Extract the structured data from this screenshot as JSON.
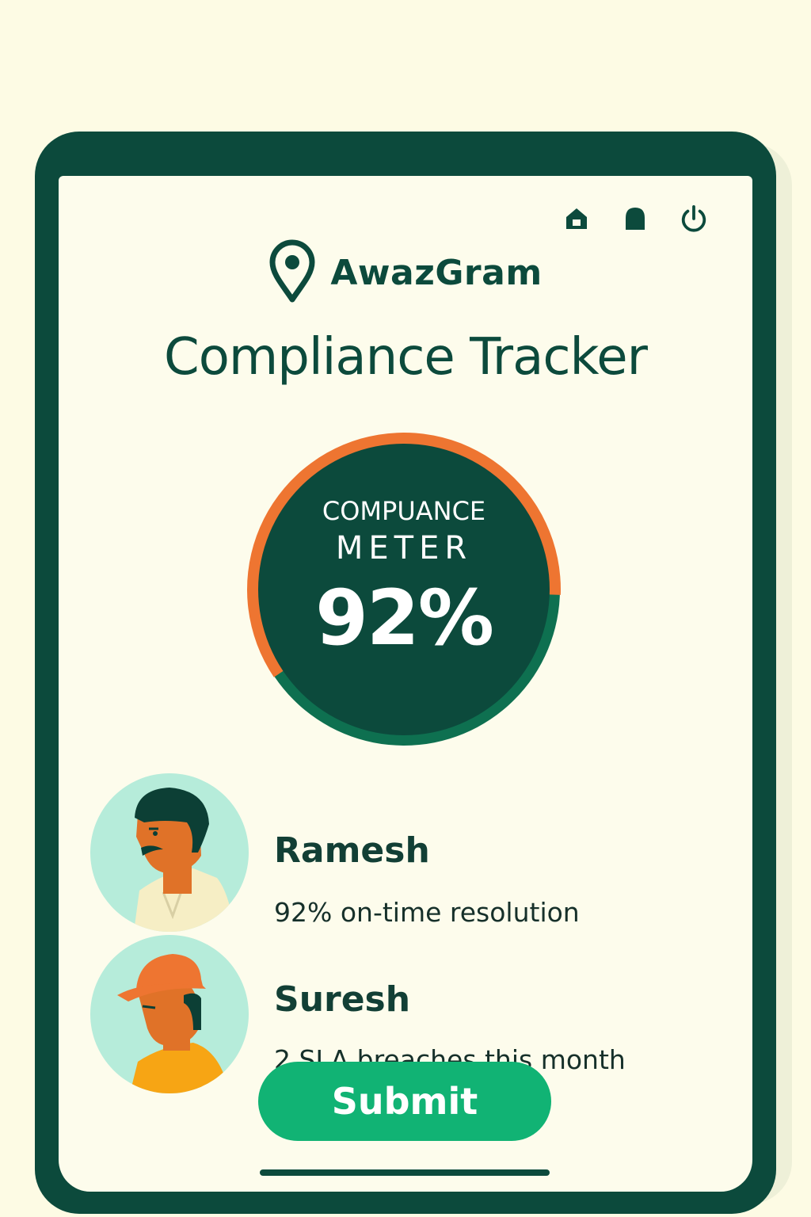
{
  "top_icons": [
    "home-icon",
    "bell-icon",
    "power-icon"
  ],
  "brand": {
    "name": "AwazGram",
    "icon": "location-pin-icon"
  },
  "title": "Compliance Tracker",
  "meter": {
    "line1": "COMPUANCE",
    "line2": "METER",
    "value_label": "92%",
    "value": 92
  },
  "people": [
    {
      "name": "Ramesh",
      "detail": "92% on-time resolution"
    },
    {
      "name": "Suresh",
      "detail": "2 SLA breaches this month"
    }
  ],
  "submit_label": "Submit",
  "colors": {
    "primary": "#0c4a3c",
    "accent_orange": "#ee7531",
    "accent_green": "#11b374",
    "background": "#fdfbe4"
  }
}
